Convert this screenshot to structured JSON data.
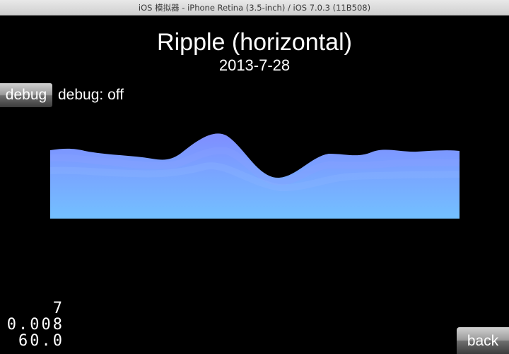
{
  "window": {
    "title": "iOS 模拟器 - iPhone Retina (3.5-inch) / iOS 7.0.3 (11B508)"
  },
  "screen": {
    "title": "Ripple (horizontal)",
    "date": "2013-7-28",
    "debug_button_label": "debug",
    "debug_status": "debug: off",
    "back_button_label": "back",
    "stats": {
      "line1": "7",
      "line2": "0.008",
      "line3": "60.0"
    }
  },
  "colors": {
    "background": "#000000",
    "wave_top": "#7f8cff",
    "wave_bottom": "#73c0ff",
    "text": "#ffffff"
  }
}
